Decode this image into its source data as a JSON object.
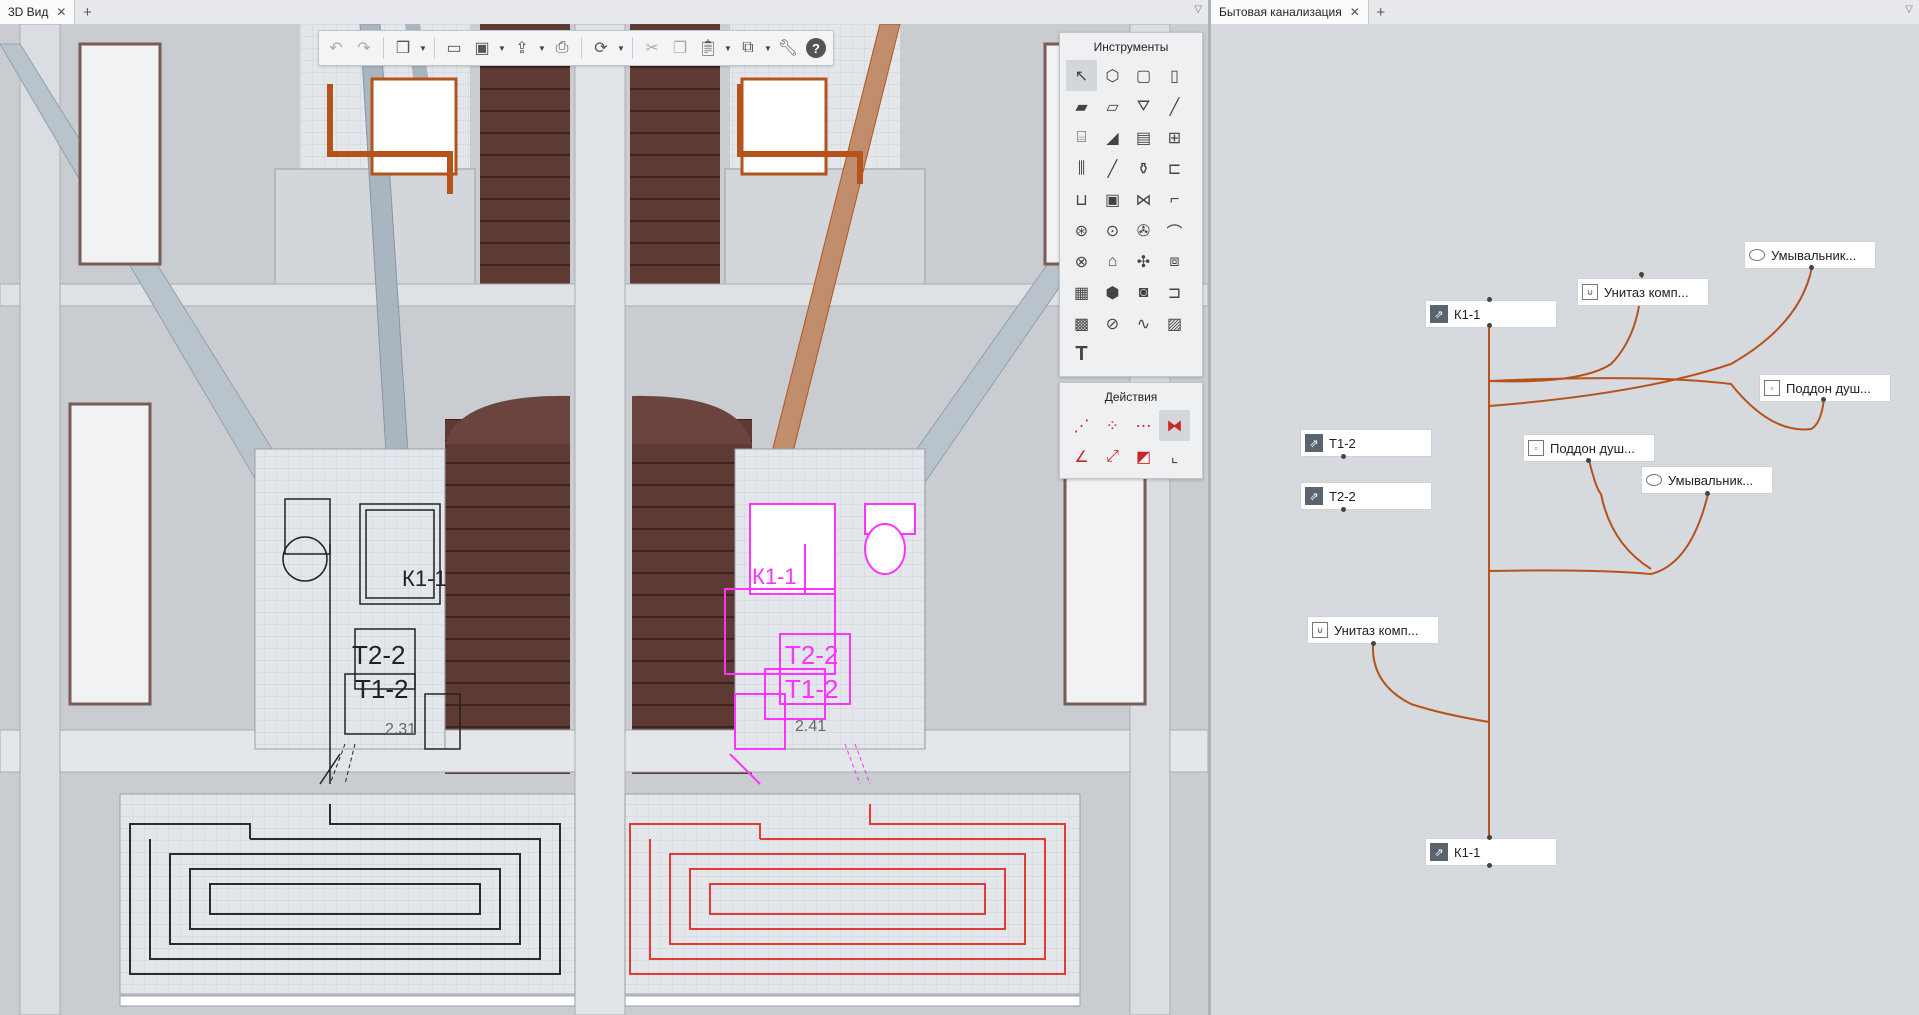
{
  "left_tab": {
    "label": "3D Вид",
    "close": "✕",
    "add": "+"
  },
  "right_tab": {
    "label": "Бытовая канализация",
    "close": "✕",
    "add": "+"
  },
  "tab_menu": "▽",
  "toolbar": {
    "icons": [
      "undo-icon",
      "redo-icon",
      "view-cube-icon",
      "open-folder-icon",
      "save-icon",
      "export-icon",
      "print-icon",
      "render-icon",
      "cut-icon",
      "copy-icon",
      "paste-icon",
      "windows-icon",
      "settings-icon",
      "help-icon"
    ],
    "help_label": "?"
  },
  "tools_panel": {
    "title": "Инструменты",
    "tools": [
      "select-icon",
      "object-icon",
      "wall-icon",
      "column-icon",
      "slab-icon",
      "floor-icon",
      "roof-icon",
      "beam-icon",
      "stair-icon",
      "ramp-icon",
      "door-icon",
      "window-icon",
      "railing-icon",
      "line-icon",
      "equipment-icon",
      "pipe-fitting-icon",
      "sink-icon",
      "boiler-icon",
      "valve-icon",
      "elbow-icon",
      "pump-icon",
      "meter-icon",
      "fan-icon",
      "bend-icon",
      "radiator-icon",
      "house-icon",
      "fan2-icon",
      "box-icon",
      "calculator-icon",
      "polyhedron-icon",
      "camera-icon",
      "bracket-icon",
      "image-icon",
      "measure-icon",
      "curve-icon",
      "hatch-icon",
      "text-icon"
    ],
    "text_glyph": "T"
  },
  "actions_panel": {
    "title": "Действия",
    "actions": [
      "split-icon",
      "distribute-icon",
      "join-icon",
      "mirror-icon",
      "angle-icon",
      "extend-icon",
      "align-icon",
      "corner-icon"
    ]
  },
  "model_labels": {
    "left_k": "К1-1",
    "left_t2": "Т2-2",
    "left_t1": "Т1-2",
    "left_dim": "2.31",
    "right_k": "К1-1",
    "right_t2": "Т2-2",
    "right_t1": "Т1-2",
    "right_dim": "2.41"
  },
  "schema": {
    "k_top": "К1-1",
    "t1": "Т1-2",
    "t2": "Т2-2",
    "toilet1": "Унитаз комп...",
    "wash1": "Умывальник...",
    "tray1": "Поддон душ...",
    "tray2": "Поддон душ...",
    "wash2": "Умывальник...",
    "toilet2": "Унитаз комп...",
    "k_bottom": "К1-1"
  },
  "colors": {
    "pipe": "#b5531b",
    "selected": "#ff33ff",
    "heating": "#e53935",
    "accent_dark": "#5a6470"
  }
}
